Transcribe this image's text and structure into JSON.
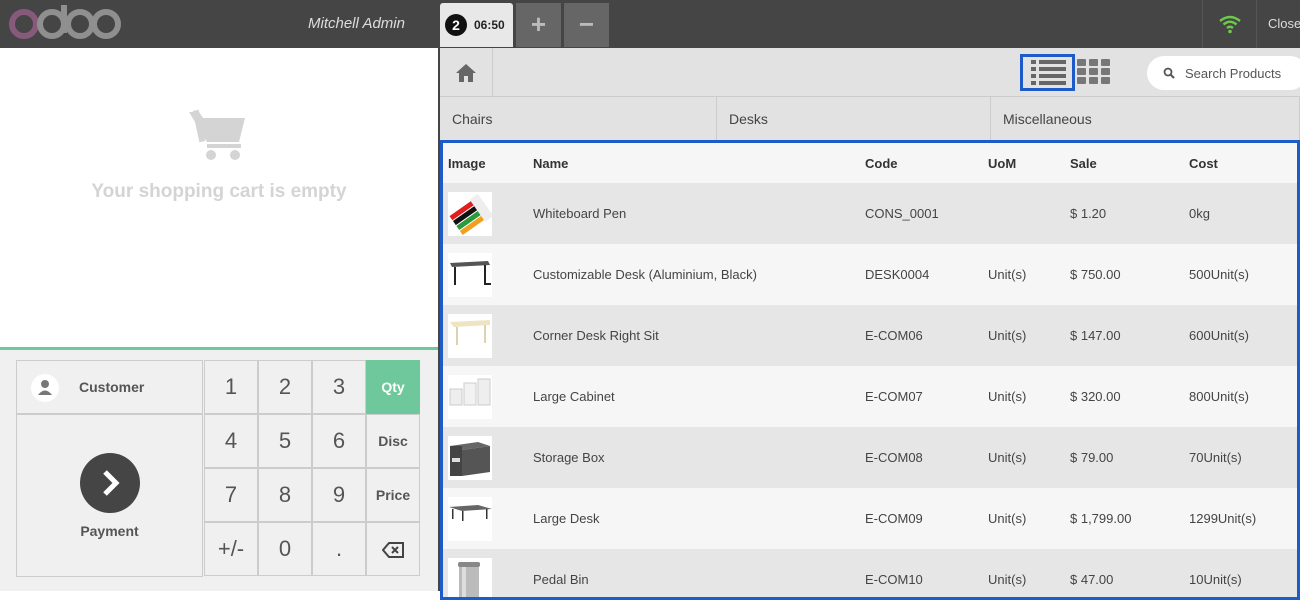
{
  "topbar": {
    "logo_text": "odoo",
    "cashier": "Mitchell Admin",
    "order": {
      "number": "2",
      "time": "06:50"
    },
    "add_label": "+",
    "remove_label": "−",
    "close_label": "Close"
  },
  "cart": {
    "empty_text": "Your shopping cart is empty"
  },
  "pad": {
    "customer_label": "Customer",
    "payment_label": "Payment",
    "keys": [
      "1",
      "2",
      "3",
      "4",
      "5",
      "6",
      "7",
      "8",
      "9",
      "+/-",
      "0",
      "."
    ],
    "modes": {
      "qty": "Qty",
      "disc": "Disc",
      "price": "Price"
    },
    "active_mode": "Qty"
  },
  "search": {
    "placeholder": "Search Products"
  },
  "categories": [
    "Chairs",
    "Desks",
    "Miscellaneous"
  ],
  "table": {
    "headers": [
      "Image",
      "Name",
      "Code",
      "UoM",
      "Sale",
      "Cost"
    ],
    "rows": [
      {
        "name": "Whiteboard Pen",
        "code": "CONS_0001",
        "uom": "",
        "sale": "$ 1.20",
        "cost": "0kg",
        "thumb": "pens"
      },
      {
        "name": "Customizable Desk (Aluminium, Black)",
        "code": "DESK0004",
        "uom": "Unit(s)",
        "sale": "$ 750.00",
        "cost": "500Unit(s)",
        "thumb": "desk-black"
      },
      {
        "name": "Corner Desk Right Sit",
        "code": "E-COM06",
        "uom": "Unit(s)",
        "sale": "$ 147.00",
        "cost": "600Unit(s)",
        "thumb": "desk-light"
      },
      {
        "name": "Large Cabinet",
        "code": "E-COM07",
        "uom": "Unit(s)",
        "sale": "$ 320.00",
        "cost": "800Unit(s)",
        "thumb": "cabinet"
      },
      {
        "name": "Storage Box",
        "code": "E-COM08",
        "uom": "Unit(s)",
        "sale": "$ 79.00",
        "cost": "70Unit(s)",
        "thumb": "box"
      },
      {
        "name": "Large Desk",
        "code": "E-COM09",
        "uom": "Unit(s)",
        "sale": "$ 1,799.00",
        "cost": "1299Unit(s)",
        "thumb": "desk-large"
      },
      {
        "name": "Pedal Bin",
        "code": "E-COM10",
        "uom": "Unit(s)",
        "sale": "$ 47.00",
        "cost": "10Unit(s)",
        "thumb": "bin"
      }
    ]
  },
  "colors": {
    "accent_green": "#6ec89b",
    "highlight_blue": "#1e5ac8",
    "topbar": "#454545"
  }
}
